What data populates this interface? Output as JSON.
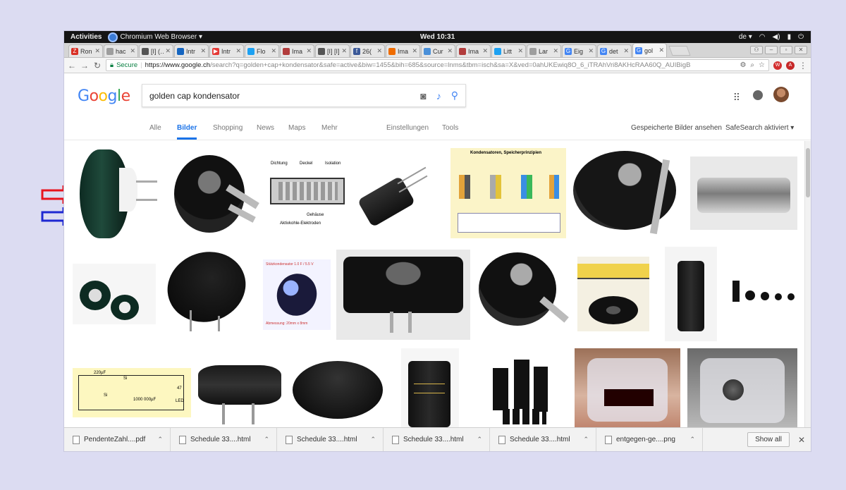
{
  "topbar": {
    "activities": "Activities",
    "app_name": "Chromium Web Browser ▾",
    "clock": "Wed 10:31",
    "lang": "de ▾",
    "tray_icons": [
      "wifi-icon",
      "volume-icon",
      "battery-icon",
      "power-icon"
    ]
  },
  "tabs": [
    {
      "fav_color": "#d93025",
      "fav_text": "Z",
      "title": "Ron"
    },
    {
      "fav_color": "#9e9e9e",
      "fav_text": "",
      "title": "hac"
    },
    {
      "fav_color": "#555555",
      "fav_text": "",
      "title": "[I] (…"
    },
    {
      "fav_color": "#1565c0",
      "fav_text": "",
      "title": "Intr"
    },
    {
      "fav_color": "#e53935",
      "fav_text": "▶",
      "title": "Intr"
    },
    {
      "fav_color": "#1da1f2",
      "fav_text": "",
      "title": "Flo"
    },
    {
      "fav_color": "#b23c3c",
      "fav_text": "",
      "title": "Ima"
    },
    {
      "fav_color": "#555555",
      "fav_text": "",
      "title": "[I] [I]"
    },
    {
      "fav_color": "#3b5998",
      "fav_text": "f",
      "title": "26("
    },
    {
      "fav_color": "#ef6c00",
      "fav_text": "",
      "title": "Ima"
    },
    {
      "fav_color": "#4a90d9",
      "fav_text": "",
      "title": "Cur"
    },
    {
      "fav_color": "#b23c3c",
      "fav_text": "",
      "title": "Ima"
    },
    {
      "fav_color": "#1da1f2",
      "fav_text": "",
      "title": "Litt"
    },
    {
      "fav_color": "#9e9e9e",
      "fav_text": "",
      "title": "Lar"
    },
    {
      "fav_color": "#4285f4",
      "fav_text": "G",
      "title": "Eig"
    },
    {
      "fav_color": "#4285f4",
      "fav_text": "G",
      "title": "det"
    },
    {
      "fav_color": "#4285f4",
      "fav_text": "G",
      "title": "gol"
    }
  ],
  "address": {
    "secure_label": "Secure",
    "url_scheme_host": "https://www.google.ch",
    "url_rest": "/search?q=golden+cap+kondensator&safe=active&biw=1455&bih=685&source=lnms&tbm=isch&sa=X&ved=0ahUKEwiq8O_6_iTRAhVri8AKHcRAA60Q_AUIBigB"
  },
  "google": {
    "logo": [
      "G",
      "o",
      "o",
      "g",
      "l",
      "e"
    ],
    "query": "golden cap kondensator",
    "tabs": [
      "Alle",
      "Bilder",
      "Shopping",
      "News",
      "Maps",
      "Mehr"
    ],
    "settings": "Einstellungen",
    "tools": "Tools",
    "saved_images": "Gespeicherte Bilder ansehen",
    "safesearch": "SafeSearch aktiviert ▾"
  },
  "diagram_labels": {
    "dichtung": "Dichtung",
    "deckel": "Deckel",
    "isolation": "Isolation",
    "gehaeuse": "Gehäuse",
    "elektroden": "Aktivkohle-Elektroden",
    "chart_title": "Kondensatoren, Speicherprinzipien",
    "small_title": "Stützkondensator 1.0 F / 5.5 V",
    "small_caption": "Abmessung: 20mm x 8mm",
    "circuit_c1": "220µF",
    "circuit_c2": "1000 000µF",
    "circuit_d1": "Si",
    "circuit_d2": "Si",
    "circuit_r": "47",
    "circuit_led": "LED"
  },
  "downloads": [
    {
      "name": "PendenteZahl....pdf"
    },
    {
      "name": "Schedule 33....html"
    },
    {
      "name": "Schedule 33....html"
    },
    {
      "name": "Schedule 33....html"
    },
    {
      "name": "Schedule 33....html"
    },
    {
      "name": "entgegen-ge....png"
    }
  ],
  "show_all": "Show all",
  "colors": {
    "arrow_top": "#e8141e",
    "arrow_bottom": "#1e28d2",
    "google_blue": "#1a73e8"
  }
}
